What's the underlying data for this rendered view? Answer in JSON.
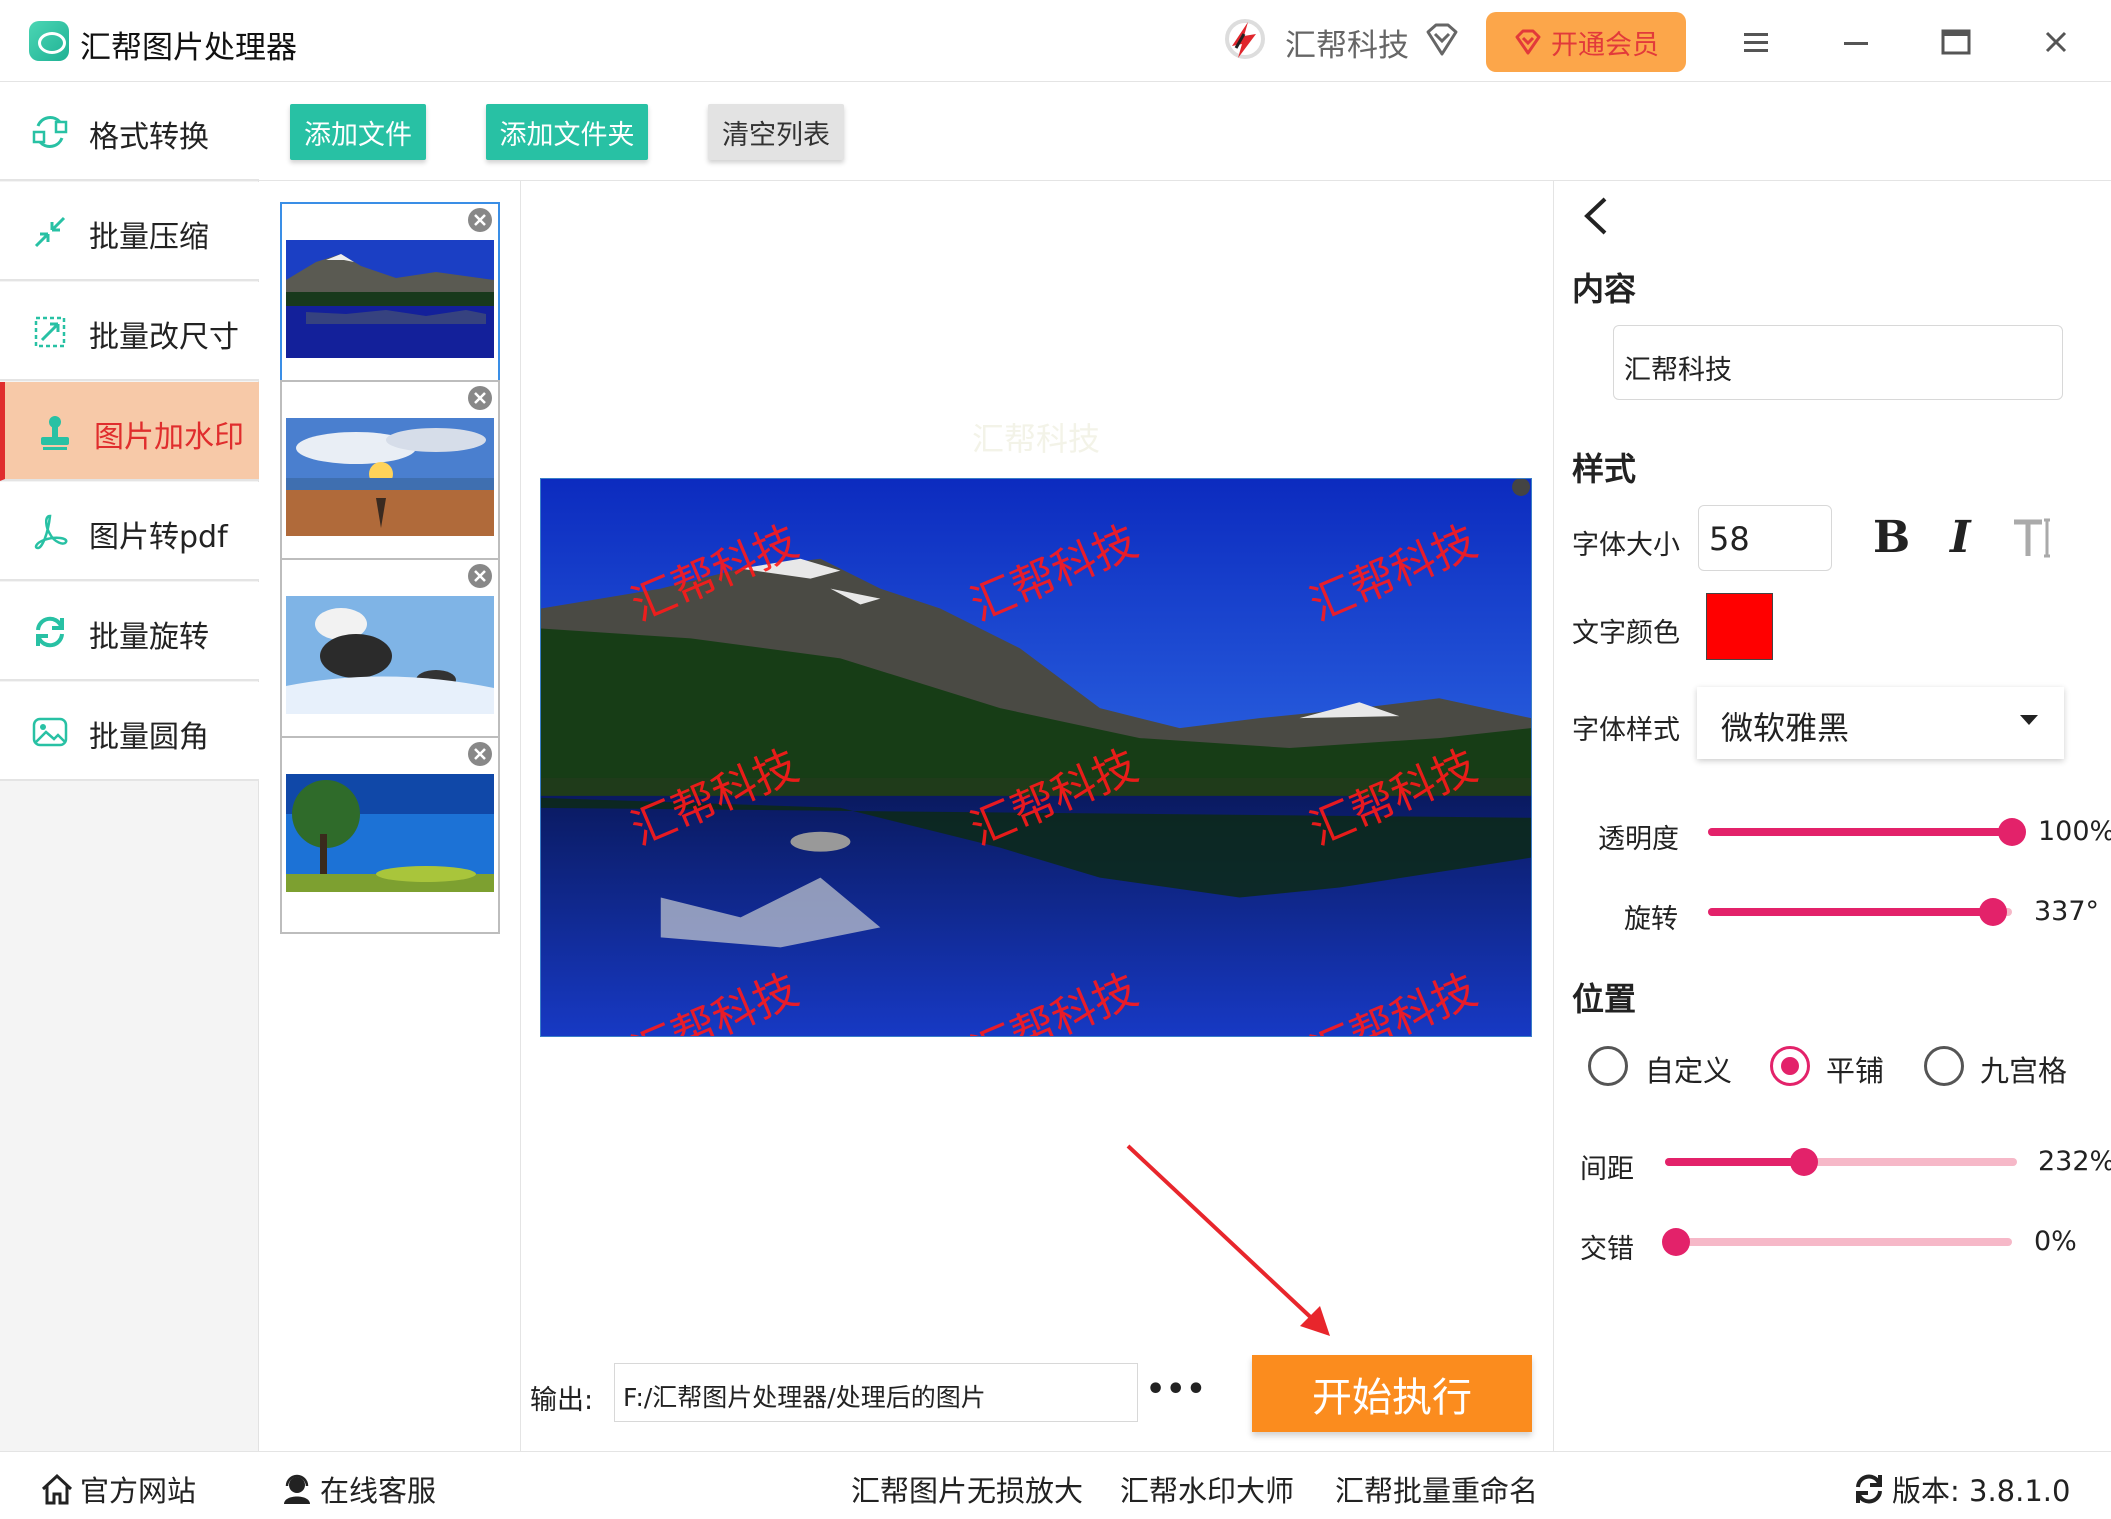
{
  "app": {
    "title": "汇帮图片处理器",
    "brand_name": "汇帮科技",
    "vip_label": "开通会员"
  },
  "sidebar": {
    "items": [
      {
        "label": "格式转换",
        "icon": "format-convert-icon"
      },
      {
        "label": "批量压缩",
        "icon": "compress-icon"
      },
      {
        "label": "批量改尺寸",
        "icon": "resize-icon"
      },
      {
        "label": "图片加水印",
        "icon": "watermark-stamp-icon",
        "active": true
      },
      {
        "label": "图片转pdf",
        "icon": "pdf-icon"
      },
      {
        "label": "批量旋转",
        "icon": "rotate-icon"
      },
      {
        "label": "批量圆角",
        "icon": "round-corner-image-icon"
      }
    ]
  },
  "toolbar": {
    "add_file": "添加文件",
    "add_folder": "添加文件夹",
    "clear_list": "清空列表"
  },
  "thumbnails": [
    {
      "subject": "mountain lake",
      "selected": true
    },
    {
      "subject": "sunset beach"
    },
    {
      "subject": "snowy trees"
    },
    {
      "subject": "tree on blue sky"
    }
  ],
  "preview": {
    "watermark_text": "汇帮科技"
  },
  "output": {
    "label": "输出:",
    "path": "F:/汇帮图片处理器/处理后的图片",
    "more": "•••",
    "start_label": "开始执行"
  },
  "panel": {
    "content_title": "内容",
    "content_value": "汇帮科技",
    "style_title": "样式",
    "font_size_label": "字体大小",
    "font_size_value": "58",
    "bold_label": "B",
    "italic_label": "I",
    "text_color_label": "文字颜色",
    "text_color": "#ff0000",
    "font_style_label": "字体样式",
    "font_style_value": "微软雅黑",
    "opacity_label": "透明度",
    "opacity_value": "100%",
    "opacity_fraction": 1.0,
    "rotation_label": "旋转",
    "rotation_value": "337°",
    "rotation_fraction": 0.936,
    "position_title": "位置",
    "position_options": [
      "自定义",
      "平铺",
      "九宫格"
    ],
    "position_selected": "平铺",
    "spacing_label": "间距",
    "spacing_value": "232%",
    "spacing_fraction": 0.396,
    "offset_label": "交错",
    "offset_value": "0%",
    "offset_fraction": 0.0
  },
  "bottom": {
    "website": "官方网站",
    "support": "在线客服",
    "link1": "汇帮图片无损放大",
    "link2": "汇帮水印大师",
    "link3": "汇帮批量重命名",
    "version": "版本: 3.8.1.0"
  },
  "colors": {
    "accent_green": "#28c1a4",
    "accent_orange": "#fb8c1e",
    "active_red": "#e02d2d",
    "slider_pink": "#e3226a"
  }
}
